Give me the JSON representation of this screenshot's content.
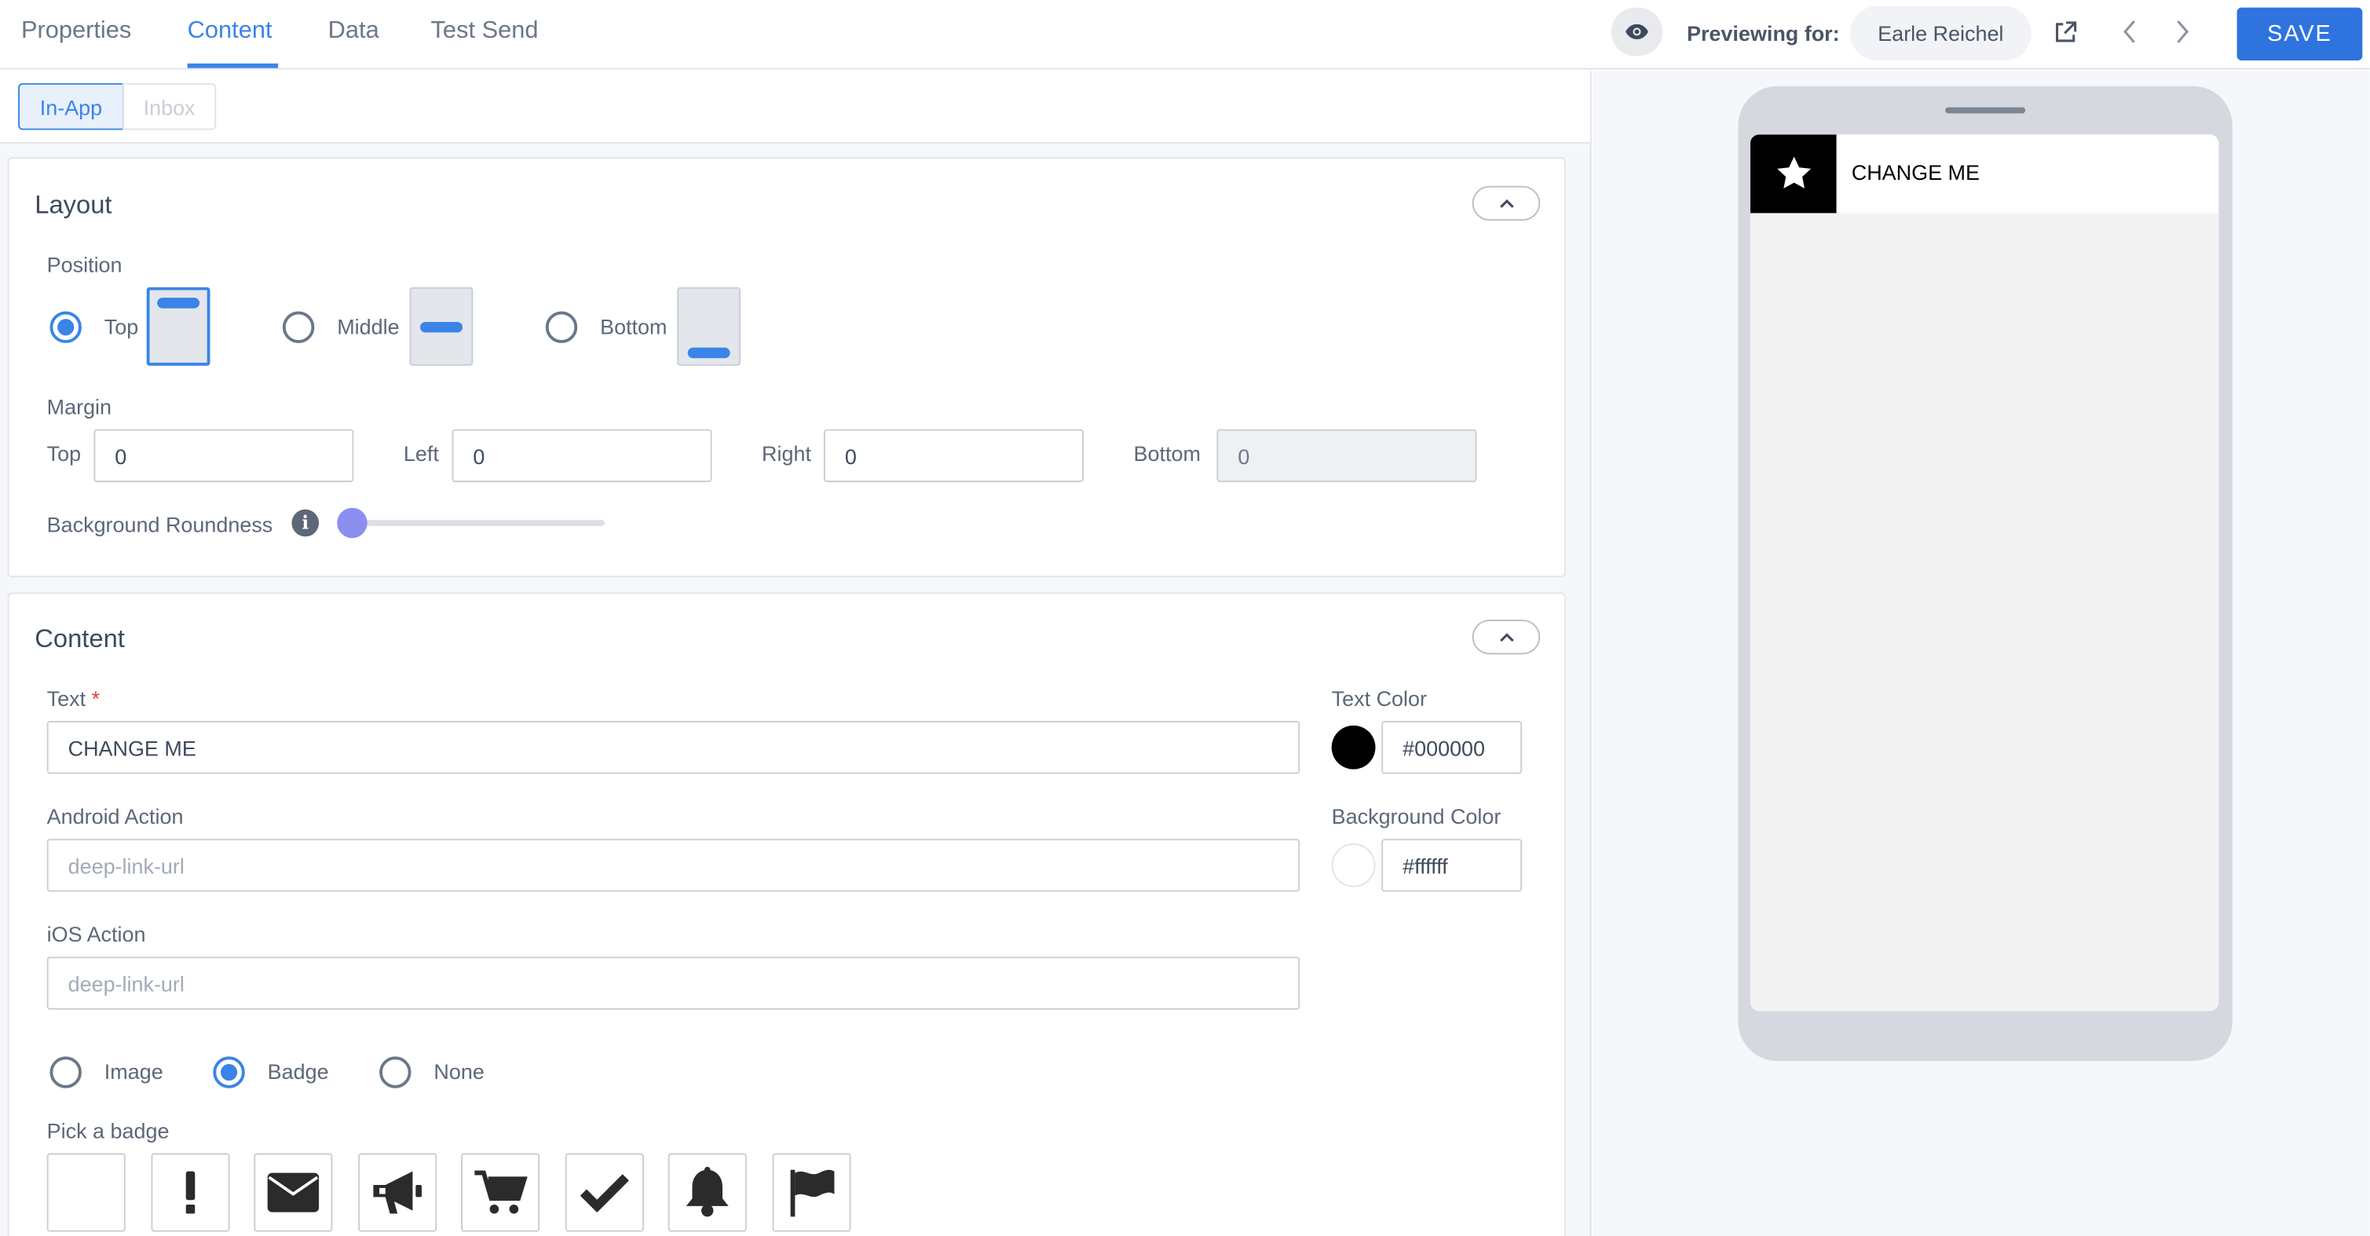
{
  "tabs": [
    {
      "label": "Properties"
    },
    {
      "label": "Content"
    },
    {
      "label": "Data"
    },
    {
      "label": "Test Send"
    }
  ],
  "active_tab": "Content",
  "header": {
    "previewing_label": "Previewing for:",
    "preview_user": "Earle Reichel",
    "save_label": "SAVE"
  },
  "subtabs": [
    {
      "label": "In-App",
      "active": true
    },
    {
      "label": "Inbox",
      "active": false
    }
  ],
  "layout": {
    "title": "Layout",
    "position_label": "Position",
    "positions": [
      {
        "label": "Top",
        "selected": true
      },
      {
        "label": "Middle",
        "selected": false
      },
      {
        "label": "Bottom",
        "selected": false
      }
    ],
    "margin_label": "Margin",
    "margins": [
      {
        "label": "Top",
        "value": "0"
      },
      {
        "label": "Left",
        "value": "0"
      },
      {
        "label": "Right",
        "value": "0"
      },
      {
        "label": "Bottom",
        "value": "0",
        "disabled": true
      }
    ],
    "roundness_label": "Background Roundness",
    "roundness_value": 0
  },
  "content": {
    "title": "Content",
    "text_label": "Text",
    "required_mark": "*",
    "text_value": "CHANGE ME",
    "text_color_label": "Text Color",
    "text_color": "#000000",
    "android_label": "Android Action",
    "android_placeholder": "deep-link-url",
    "bg_color_label": "Background Color",
    "bg_color": "#ffffff",
    "ios_label": "iOS Action",
    "ios_placeholder": "deep-link-url",
    "media_options": [
      {
        "label": "Image",
        "selected": false
      },
      {
        "label": "Badge",
        "selected": true
      },
      {
        "label": "None",
        "selected": false
      }
    ],
    "pick_badge_label": "Pick a badge",
    "badges": [
      "blank",
      "exclamation-icon",
      "envelope-icon",
      "megaphone-icon",
      "cart-icon",
      "check-icon",
      "bell-icon",
      "flag-icon"
    ]
  },
  "preview": {
    "notification_text": "CHANGE ME",
    "badge_icon": "star-icon"
  },
  "colors": {
    "accent": "#3a84e8",
    "save": "#2f74de"
  }
}
